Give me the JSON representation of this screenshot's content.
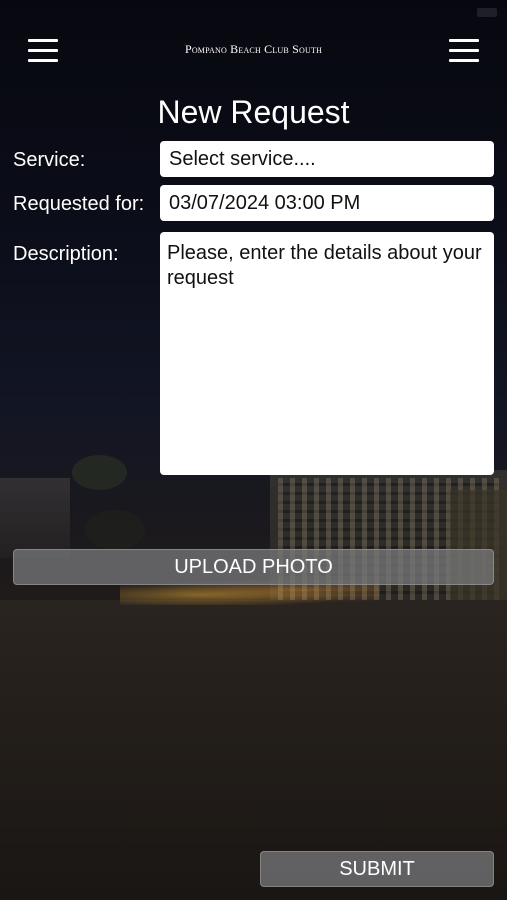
{
  "header": {
    "title": "Pompano Beach Club South"
  },
  "page": {
    "title": "New Request"
  },
  "form": {
    "service_label": "Service:",
    "service_value": "Select service....",
    "requested_for_label": "Requested for:",
    "requested_for_value": "03/07/2024 03:00 PM",
    "description_label": "Description:",
    "description_placeholder": "Please, enter the details about your request"
  },
  "buttons": {
    "upload_photo": "UPLOAD PHOTO",
    "submit": "SUBMIT"
  },
  "icons": {
    "left_menu": "hamburger-menu-icon",
    "right_menu": "hamburger-menu-icon"
  },
  "colors": {
    "field_bg": "#ffffff",
    "button_bg": "#7a7c7e",
    "text": "#ffffff"
  }
}
